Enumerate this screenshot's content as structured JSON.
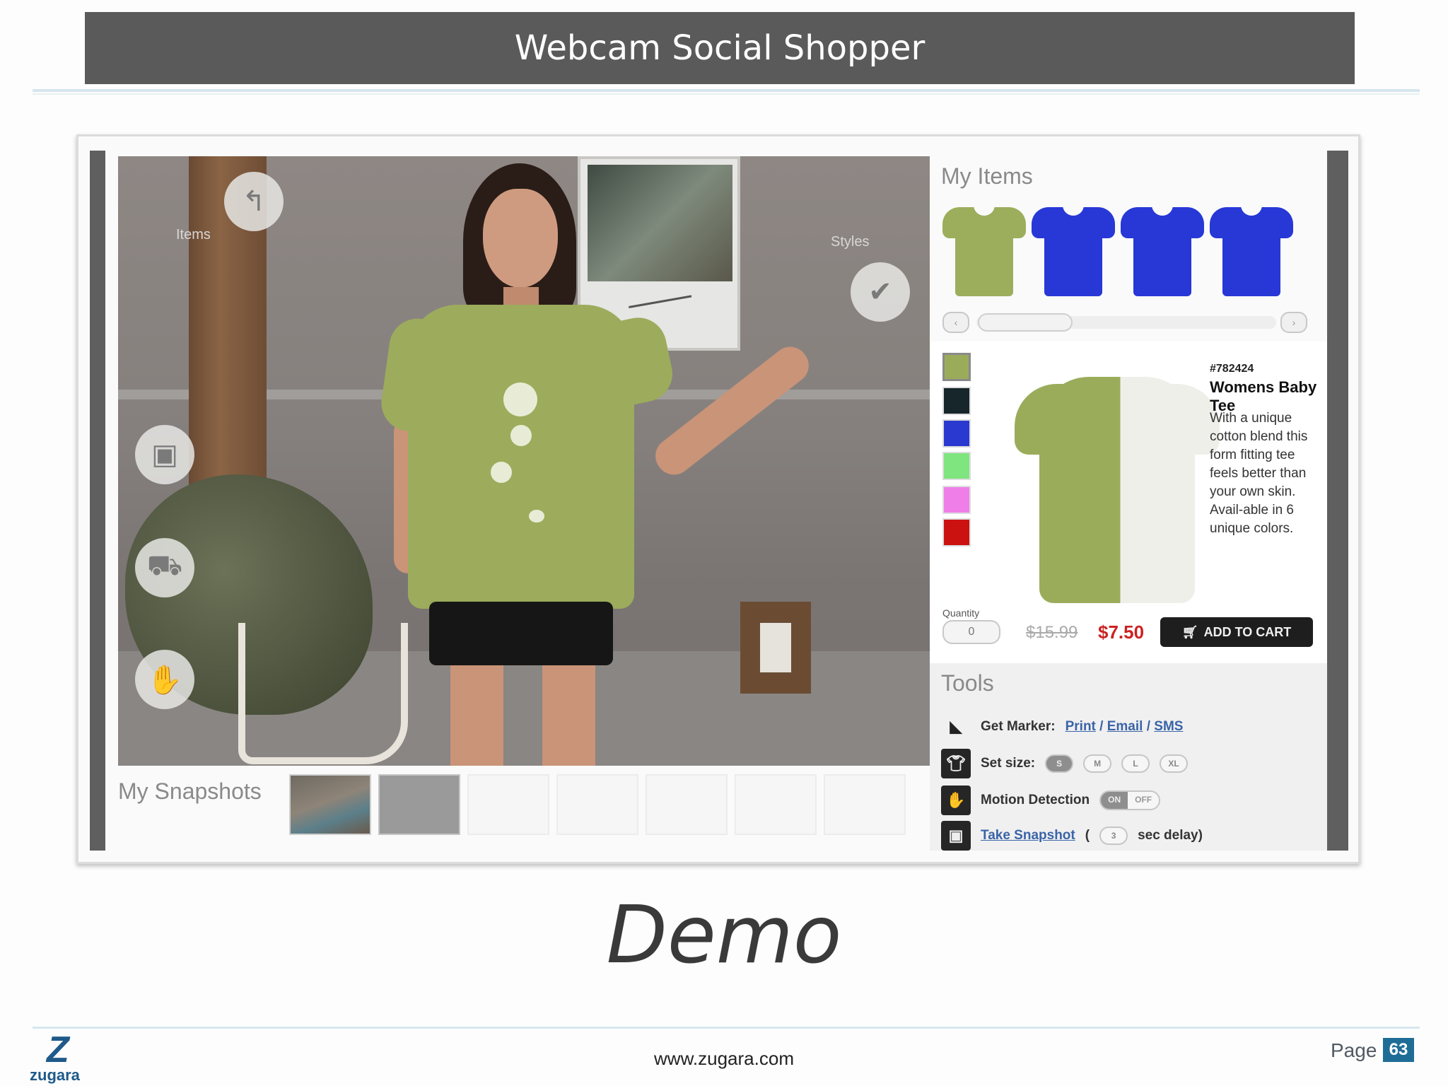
{
  "slide": {
    "title": "Webcam Social Shopper",
    "demo_label": "Demo",
    "footer_url": "www.zugara.com",
    "page_label": "Page",
    "page_number": "63",
    "logo_text": "zugara"
  },
  "app": {
    "overlay": {
      "items_label": "Items",
      "styles_label": "Styles"
    },
    "snapshots": {
      "label": "My Snapshots",
      "slots": [
        "filled",
        "gray",
        "empty",
        "empty",
        "empty",
        "empty",
        "empty"
      ]
    },
    "my_items": {
      "title": "My Items",
      "tees": [
        {
          "color": "#9cae5c"
        },
        {
          "color": "#2738d6"
        },
        {
          "color": "#2738d6"
        },
        {
          "color": "#2738d6"
        }
      ],
      "scroll_left": "‹",
      "scroll_right": "›"
    },
    "product": {
      "swatches": [
        "#9aac5a",
        "#17262a",
        "#2a3ad0",
        "#7fe57f",
        "#f07ee8",
        "#cc1111"
      ],
      "sku": "#782424",
      "name": "Womens Baby Tee",
      "description": "With a unique cotton blend this form fitting tee feels better than your own skin. Avail-able in 6 unique colors.",
      "quantity_label": "Quantity",
      "quantity_value": "0",
      "old_price": "$15.99",
      "new_price": "$7.50",
      "add_to_cart": "ADD TO CART"
    },
    "tools": {
      "title": "Tools",
      "get_marker_label": "Get Marker:",
      "get_marker_links": [
        "Print",
        "Email",
        "SMS"
      ],
      "set_size_label": "Set size:",
      "sizes": [
        "S",
        "M",
        "L",
        "XL"
      ],
      "motion_label": "Motion Detection",
      "motion_on": "ON",
      "motion_off": "OFF",
      "snapshot_link": "Take Snapshot",
      "snapshot_open": "(",
      "snapshot_delay": "3",
      "snapshot_suffix": "sec delay)"
    }
  }
}
